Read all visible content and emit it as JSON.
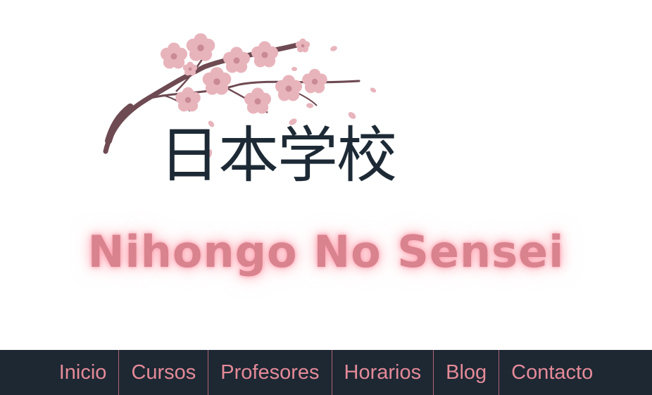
{
  "logo": {
    "kanji": "日本学校",
    "icon": "cherry-blossom-branch"
  },
  "site": {
    "name": "Nihongo No Sensei"
  },
  "colors": {
    "accent": "#d9838f",
    "nav_background": "#1d2833",
    "nav_text": "#e58a98",
    "kanji": "#1d2a35",
    "blossom": "#e8b4bc",
    "branch": "#6e4a52"
  },
  "nav": {
    "items": [
      {
        "label": "Inicio"
      },
      {
        "label": "Cursos"
      },
      {
        "label": "Profesores"
      },
      {
        "label": "Horarios"
      },
      {
        "label": "Blog"
      },
      {
        "label": "Contacto"
      }
    ]
  }
}
